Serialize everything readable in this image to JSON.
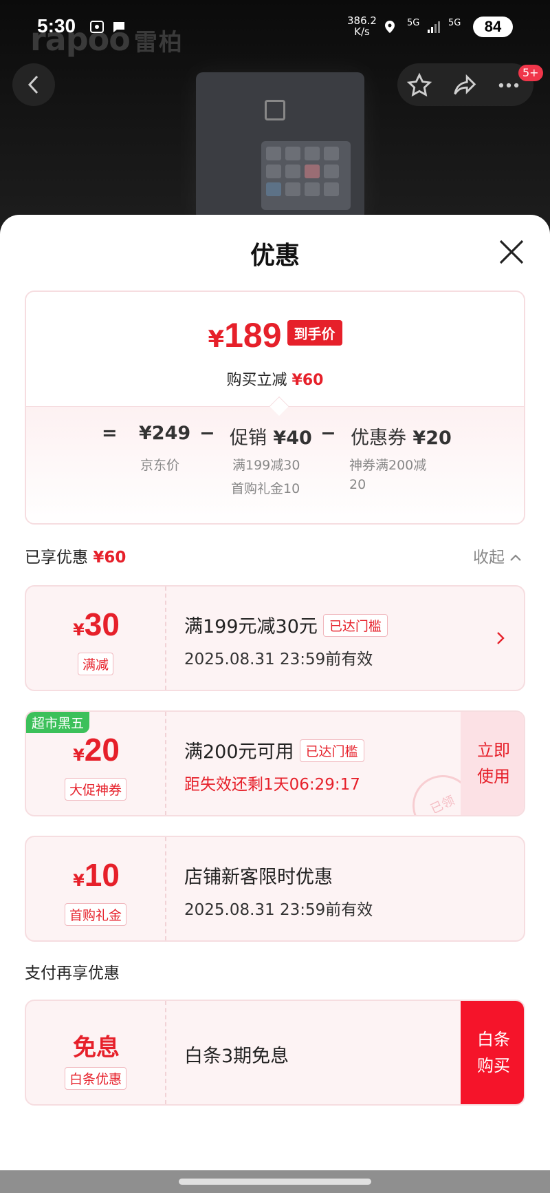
{
  "status_bar": {
    "time": "5:30",
    "net_speed": "386.2",
    "net_unit": "K/s",
    "sig1": "5G",
    "sig2": "5G",
    "battery": "84"
  },
  "brand": {
    "latin": "rapoo",
    "cn": "雷柏"
  },
  "nav": {
    "notification_badge": "5+"
  },
  "sheet": {
    "title": "优惠"
  },
  "summary": {
    "currency": "¥",
    "final_price": "189",
    "final_tag": "到手价",
    "saving_prefix": "购买立减",
    "saving_value": "¥60",
    "eq_sign": "=",
    "jd_price": "¥249",
    "minus1": "−",
    "promo_label": "促销",
    "promo_value": "¥40",
    "minus2": "−",
    "coupon_label": "优惠券",
    "coupon_value": "¥20",
    "jd_price_label": "京东价",
    "promo_detail_1": "满199减30",
    "promo_detail_2": "首购礼金10",
    "coupon_detail_1": "神券满200减",
    "coupon_detail_2": "20"
  },
  "enjoyed": {
    "label": "已享优惠",
    "value": "¥60",
    "collapse": "收起"
  },
  "coupons": [
    {
      "currency": "¥",
      "amount": "30",
      "type": "满减",
      "title": "满199元减30元",
      "status": "已达门槛",
      "detail": "2025.08.31 23:59前有效"
    },
    {
      "ribbon": "超市黑五",
      "currency": "¥",
      "amount": "20",
      "type": "大促神券",
      "title": "满200元可用",
      "status": "已达门槛",
      "detail": "距失效还剩1天06:29:17",
      "action_1": "立即",
      "action_2": "使用",
      "stamp": "已领"
    },
    {
      "currency": "¥",
      "amount": "10",
      "type": "首购礼金",
      "title": "店铺新客限时优惠",
      "detail": "2025.08.31 23:59前有效"
    }
  ],
  "pay_section": {
    "label": "支付再享优惠",
    "card": {
      "amount": "免息",
      "type": "白条优惠",
      "title": "白条3期免息",
      "action_1": "白条",
      "action_2": "购买"
    }
  },
  "colors": {
    "accent": "#e6202a",
    "ribbon": "#3cc05a",
    "buy": "#f5142a"
  }
}
